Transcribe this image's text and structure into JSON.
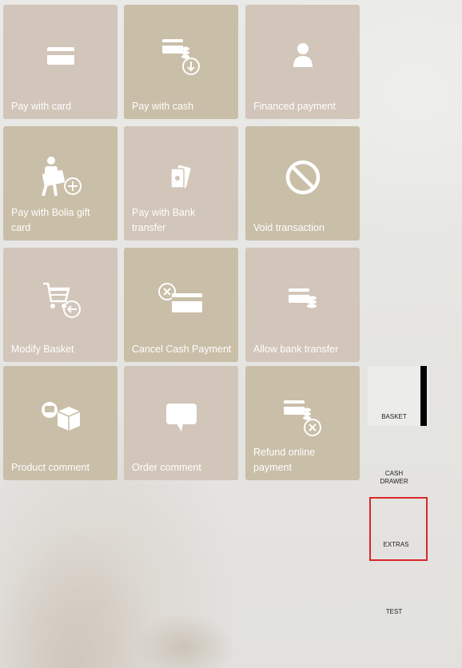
{
  "tiles": [
    {
      "label": "Pay with card",
      "icon": "credit-card-icon"
    },
    {
      "label": "Pay with cash",
      "icon": "cash-download-icon"
    },
    {
      "label": "Financed payment",
      "icon": "person-icon"
    },
    {
      "label": "Pay with Bolia gift card",
      "icon": "gift-card-add-icon"
    },
    {
      "label": "Pay with Bank transfer",
      "icon": "bank-notes-icon"
    },
    {
      "label": "Void transaction",
      "icon": "prohibited-icon"
    },
    {
      "label": "Modify Basket",
      "icon": "cart-back-icon"
    },
    {
      "label": "Cancel Cash Payment",
      "icon": "card-cancel-icon"
    },
    {
      "label": "Allow bank transfer",
      "icon": "card-coins-icon"
    },
    {
      "label": "Product comment",
      "icon": "box-comment-icon"
    },
    {
      "label": "Order comment",
      "icon": "speech-bubble-icon"
    },
    {
      "label": "Refund online payment",
      "icon": "card-coins-cancel-icon"
    }
  ],
  "side_menu": {
    "basket": "BASKET",
    "cash_drawer": "CASH DRAWER",
    "extras": "EXTRAS",
    "test": "TEST"
  },
  "colors": {
    "tile_light": "#d2c5b9",
    "tile_dark": "#c9bea7",
    "selected_border": "#d9262b"
  }
}
